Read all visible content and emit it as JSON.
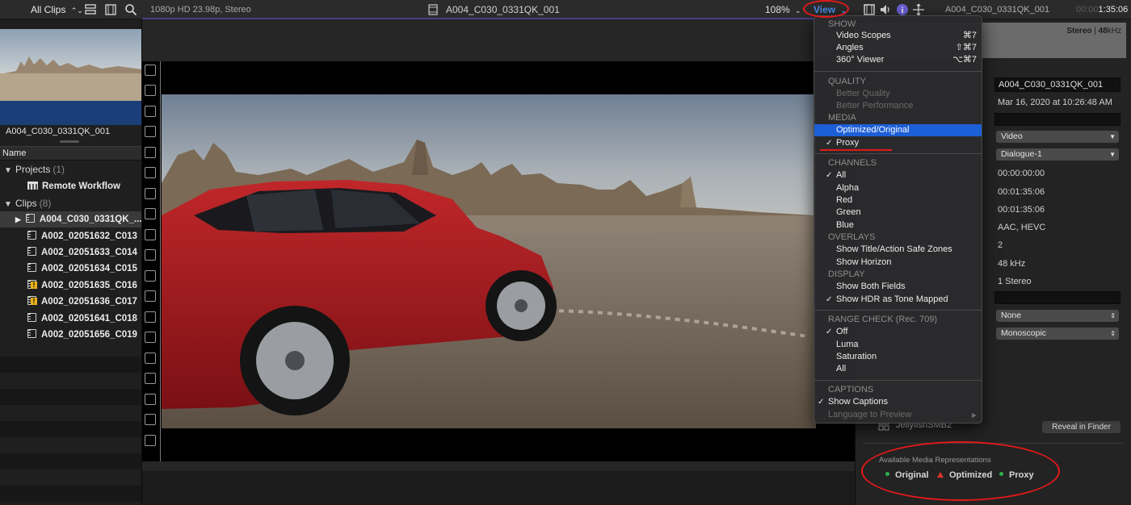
{
  "topbar": {
    "library_filter": "All Clips",
    "format_info": "1080p HD 23.98p, Stereo",
    "clip_name": "A004_C030_0331QK_001",
    "zoom": "108%",
    "view_label": "View",
    "inspector_clip_name": "A004_C030_0331QK_001",
    "timecode_dim": "00:00",
    "timecode": "1:35:06"
  },
  "sidebar": {
    "thumb_label": "A004_C030_0331QK_001",
    "name_header": "Name",
    "projects_label": "Projects",
    "projects_count": "(1)",
    "project_items": [
      "Remote Workflow"
    ],
    "clips_label": "Clips",
    "clips_count": "(8)",
    "clips": [
      {
        "name": "A004_C030_0331QK_...",
        "warn": false
      },
      {
        "name": "A002_02051632_C013",
        "warn": false
      },
      {
        "name": "A002_02051633_C014",
        "warn": false
      },
      {
        "name": "A002_02051634_C015",
        "warn": false
      },
      {
        "name": "A002_02051635_C016",
        "warn": true
      },
      {
        "name": "A002_02051636_C017",
        "warn": true
      },
      {
        "name": "A002_02051641_C018",
        "warn": false
      },
      {
        "name": "A002_02051656_C019",
        "warn": false
      }
    ]
  },
  "inspector": {
    "audio_label": "Stereo",
    "audio_rate_bold": "48",
    "audio_rate_unit": "kHz",
    "name_value": "A004_C030_0331QK_001",
    "date": "Mar 16, 2020 at 10:26:48 AM",
    "roles_video": "Video",
    "roles_audio": "Dialogue-1",
    "start": "00:00:00:00",
    "end": "00:01:35:06",
    "duration": "00:01:35:06",
    "codecs": "AAC, HEVC",
    "channels_count": "2",
    "sample_rate": "48 kHz",
    "audio_config": "1 Stereo",
    "popup_none": "None",
    "popup_mono": "Monoscopic",
    "location": "JellyfishSMB2",
    "reveal": "Reveal in Finder",
    "media_reps_title": "Available Media Representations",
    "rep_original": "Original",
    "rep_optimized": "Optimized",
    "rep_proxy": "Proxy",
    "rep_colors": {
      "ok": "#2db34a",
      "warn": "#e0322c"
    }
  },
  "menu": {
    "show_head": "SHOW",
    "video_scopes": "Video Scopes",
    "video_scopes_sc": "⌘7",
    "angles": "Angles",
    "angles_sc": "⇧⌘7",
    "viewer360": "360° Viewer",
    "viewer360_sc": "⌥⌘7",
    "quality_head": "QUALITY",
    "better_quality": "Better Quality",
    "better_performance": "Better Performance",
    "media_head": "MEDIA",
    "optimized_original": "Optimized/Original",
    "proxy": "Proxy",
    "channels_head": "CHANNELS",
    "all": "All",
    "alpha": "Alpha",
    "red": "Red",
    "green": "Green",
    "blue": "Blue",
    "overlays_head": "OVERLAYS",
    "safe_zones": "Show Title/Action Safe Zones",
    "horizon": "Show Horizon",
    "display_head": "DISPLAY",
    "both_fields": "Show Both Fields",
    "hdr": "Show HDR as Tone Mapped",
    "range_head": "RANGE CHECK (Rec. 709)",
    "off": "Off",
    "luma": "Luma",
    "saturation": "Saturation",
    "range_all": "All",
    "captions_head": "CAPTIONS",
    "show_captions": "Show Captions",
    "language_preview": "Language to Preview",
    "check": "✓",
    "submenu_arrow": "▶"
  }
}
